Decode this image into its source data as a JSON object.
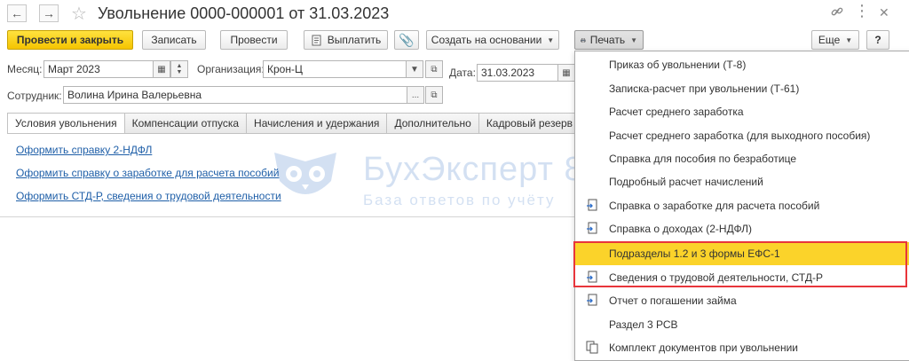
{
  "window": {
    "title": "Увольнение 0000-000001 от 31.03.2023"
  },
  "toolbar": {
    "post_close": "Провести и закрыть",
    "save": "Записать",
    "post": "Провести",
    "pay": "Выплатить",
    "create_based_on": "Создать на основании",
    "print": "Печать",
    "more": "Еще",
    "help": "?"
  },
  "form": {
    "month_label": "Месяц:",
    "month_value": "Март 2023",
    "org_label": "Организация:",
    "org_value": "Крон-Ц",
    "date_label": "Дата:",
    "date_value": "31.03.2023",
    "employee_label": "Сотрудник:",
    "employee_value": "Волина Ирина Валерьевна"
  },
  "tabs": [
    {
      "label": "Условия увольнения"
    },
    {
      "label": "Компенсации отпуска"
    },
    {
      "label": "Начисления и удержания"
    },
    {
      "label": "Дополнительно"
    },
    {
      "label": "Кадровый резерв"
    }
  ],
  "links": [
    {
      "label": "Оформить справку 2-НДФЛ"
    },
    {
      "label": "Оформить справку о заработке для расчета пособий"
    },
    {
      "label": "Оформить СТД-Р, сведения о трудовой деятельности"
    }
  ],
  "watermark": {
    "brand": "БухЭксперт 8",
    "subtitle": "База ответов по учёту"
  },
  "print_menu": {
    "items": [
      {
        "label": "Приказ об увольнении (Т-8)",
        "icon": ""
      },
      {
        "label": "Записка-расчет при увольнении (Т-61)",
        "icon": ""
      },
      {
        "label": "Расчет среднего заработка",
        "icon": ""
      },
      {
        "label": "Расчет среднего заработка (для выходного пособия)",
        "icon": ""
      },
      {
        "label": "Справка для пособия по безработице",
        "icon": ""
      },
      {
        "label": "Подробный расчет начислений",
        "icon": ""
      },
      {
        "label": "Справка о заработке для расчета пособий",
        "icon": "export-document-icon"
      },
      {
        "label": "Справка о доходах (2-НДФЛ)",
        "icon": "export-document-icon"
      },
      {
        "label": "Подразделы 1.2 и 3 формы ЕФС-1",
        "icon": "",
        "highlighted": true
      },
      {
        "label": "Сведения о трудовой деятельности, СТД-Р",
        "icon": "export-document-icon"
      },
      {
        "label": "Отчет о погашении займа",
        "icon": "export-document-icon"
      },
      {
        "label": "Раздел 3 РСВ",
        "icon": ""
      },
      {
        "label": "Комплект документов при увольнении",
        "icon": "document-set-icon"
      }
    ]
  },
  "colors": {
    "primary_button": "#f5c400",
    "highlight": "#fbd32a",
    "callout_border": "#e8353b",
    "link": "#1f5fa8"
  }
}
